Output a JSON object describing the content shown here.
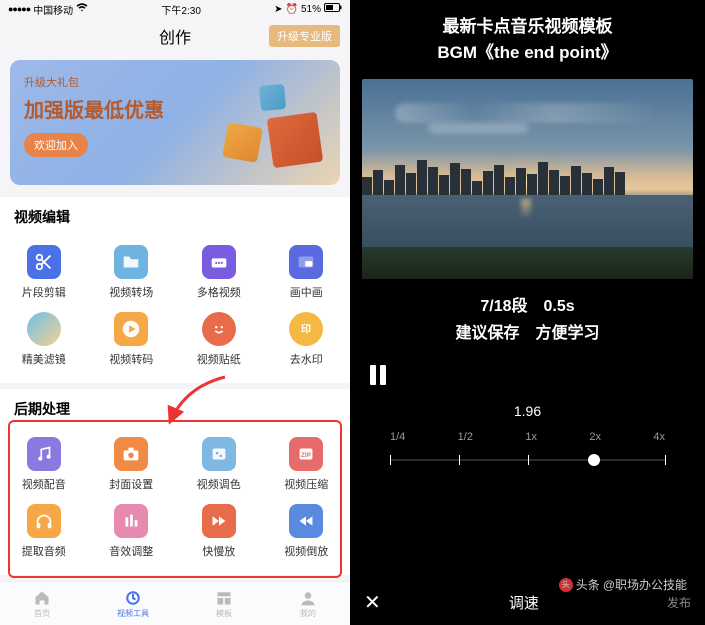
{
  "statusbar": {
    "carrier": "中国移动",
    "time": "下午2:30",
    "battery": "51%"
  },
  "header": {
    "title": "创作",
    "upgrade": "升级专业版"
  },
  "promo": {
    "small": "升级大礼包",
    "big": "加强版最低优惠",
    "button": "欢迎加入"
  },
  "sections": {
    "edit": "视频编辑",
    "post": "后期处理"
  },
  "edit_items": [
    {
      "label": "片段剪辑",
      "icon": "scissors",
      "bg": "#4a72e6"
    },
    {
      "label": "视频转场",
      "icon": "folder",
      "bg": "#6fb3e0"
    },
    {
      "label": "多格视频",
      "icon": "dots",
      "bg": "#7a5ce0"
    },
    {
      "label": "画中画",
      "icon": "pip",
      "bg": "#5a6ae0"
    },
    {
      "label": "精美滤镜",
      "icon": "circle",
      "bg": "linear-gradient(135deg,#6fc0e8,#f5d090)"
    },
    {
      "label": "视频转码",
      "icon": "play",
      "bg": "#f5a845"
    },
    {
      "label": "视频贴纸",
      "icon": "smile",
      "bg": "#e86b4a"
    },
    {
      "label": "去水印",
      "icon": "print",
      "bg": "#f5b845"
    }
  ],
  "post_items": [
    {
      "label": "视频配音",
      "icon": "music",
      "bg": "#8a7ae0"
    },
    {
      "label": "封面设置",
      "icon": "camera",
      "bg": "#f08a45"
    },
    {
      "label": "视频调色",
      "icon": "palette",
      "bg": "#7fb8e0"
    },
    {
      "label": "视频压缩",
      "icon": "zip",
      "bg": "#e86b6b"
    },
    {
      "label": "提取音频",
      "icon": "headphone",
      "bg": "#f5a845"
    },
    {
      "label": "音效调整",
      "icon": "eq",
      "bg": "#e88ab0"
    },
    {
      "label": "快慢放",
      "icon": "ff",
      "bg": "#e86b4a"
    },
    {
      "label": "视频倒放",
      "icon": "rewind",
      "bg": "#5a8ae0"
    }
  ],
  "tabs": [
    {
      "label": "首页",
      "icon": "home"
    },
    {
      "label": "视频工具",
      "icon": "tool"
    },
    {
      "label": "模板",
      "icon": "tpl"
    },
    {
      "label": "我的",
      "icon": "me"
    }
  ],
  "right": {
    "title1": "最新卡点音乐视频模板",
    "title2": "BGM《the end point》",
    "seg": "7/18段　0.5s",
    "save": "建议保存　方便学习",
    "speed_value": "1.96",
    "ticks": [
      "1/4",
      "1/2",
      "1x",
      "2x",
      "4x"
    ],
    "close": "✕",
    "speed_label": "调速",
    "publish": "发布",
    "byline_prefix": "头条",
    "byline": "@职场办公技能"
  }
}
